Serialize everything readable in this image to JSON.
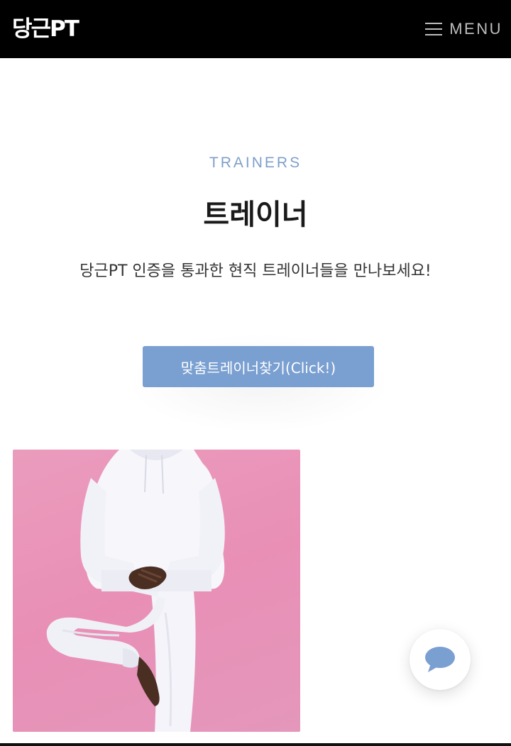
{
  "header": {
    "logo": "당근PT",
    "menu_label": "MENU"
  },
  "section": {
    "eyebrow": "TRAINERS",
    "title": "트레이너",
    "subtitle": "당근PT 인증을 통과한 현직 트레이너들을 만나보세요!"
  },
  "cta": {
    "label": "맞춤트레이너찾기(Click!)"
  },
  "icons": {
    "menu": "hamburger-icon",
    "chat": "chat-bubble-icon"
  },
  "colors": {
    "header_bg": "#000000",
    "accent": "#7a9fd1",
    "eyebrow": "#7f9fcb",
    "photo_bg": "#ea9cbd"
  }
}
